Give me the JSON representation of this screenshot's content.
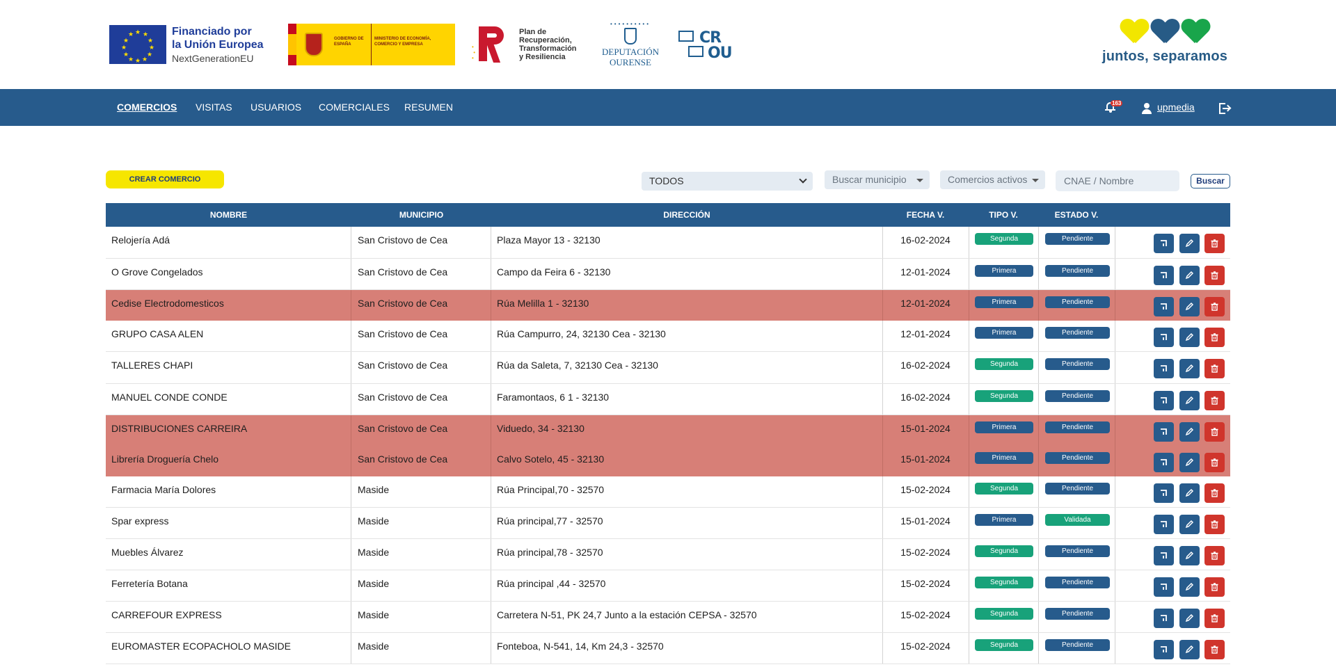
{
  "header": {
    "eu": {
      "line1": "Financiado por",
      "line2": "la Unión Europea",
      "line3": "NextGenerationEU"
    },
    "gobierno": {
      "block1": "GOBIERNO DE ESPAÑA",
      "block2": "MINISTERIO DE ECONOMÍA, COMERCIO Y EMPRESA"
    },
    "prtr": {
      "line1": "Plan de",
      "line2": "Recuperación,",
      "line3": "Transformación",
      "line4": "y Resiliencia"
    },
    "deputacion": {
      "line1": "DEPUTACIÓN",
      "line2": "OURENSE"
    },
    "crou": {
      "line1": "CR",
      "line2": "OU"
    },
    "juntos": {
      "text": "juntos, separamos"
    }
  },
  "nav": {
    "items": [
      {
        "label": "COMERCIOS",
        "active": true
      },
      {
        "label": "VISITAS",
        "active": false
      },
      {
        "label": "USUARIOS",
        "active": false
      },
      {
        "label": "COMERCIALES",
        "active": false
      },
      {
        "label": "RESUMEN",
        "active": false
      }
    ],
    "notifications_count": "163",
    "username": "upmedia"
  },
  "toolbar": {
    "crear_label": "CREAR COMERCIO",
    "filter_select_value": "TODOS",
    "municipio_placeholder": "Buscar municipio",
    "estado_value": "Comercios activos",
    "cnae_placeholder": "CNAE / Nombre",
    "buscar_label": "Buscar"
  },
  "table": {
    "columns": [
      "NOMBRE",
      "MUNICIPIO",
      "DIRECCIÓN",
      "FECHA V.",
      "TIPO V.",
      "ESTADO V."
    ],
    "rows": [
      {
        "nombre": "Relojería Adá",
        "municipio": "San Cristovo de Cea",
        "direccion": "Plaza Mayor 13 - 32130",
        "fecha": "16-02-2024",
        "tipo": "Segunda",
        "estado": "Pendiente",
        "highlight": false
      },
      {
        "nombre": "O Grove Congelados",
        "municipio": "San Cristovo de Cea",
        "direccion": "Campo da Feira 6 - 32130",
        "fecha": "12-01-2024",
        "tipo": "Primera",
        "estado": "Pendiente",
        "highlight": false
      },
      {
        "nombre": "Cedise Electrodomesticos",
        "municipio": "San Cristovo de Cea",
        "direccion": "Rúa Melilla 1 - 32130",
        "fecha": "12-01-2024",
        "tipo": "Primera",
        "estado": "Pendiente",
        "highlight": true
      },
      {
        "nombre": "GRUPO CASA ALEN",
        "municipio": "San Cristovo de Cea",
        "direccion": "Rúa Campurro, 24, 32130 Cea - 32130",
        "fecha": "12-01-2024",
        "tipo": "Primera",
        "estado": "Pendiente",
        "highlight": false
      },
      {
        "nombre": "TALLERES CHAPI",
        "municipio": "San Cristovo de Cea",
        "direccion": "Rúa da Saleta, 7, 32130 Cea - 32130",
        "fecha": "16-02-2024",
        "tipo": "Segunda",
        "estado": "Pendiente",
        "highlight": false
      },
      {
        "nombre": "MANUEL CONDE CONDE",
        "municipio": "San Cristovo de Cea",
        "direccion": "Faramontaos, 6 1 - 32130",
        "fecha": "16-02-2024",
        "tipo": "Segunda",
        "estado": "Pendiente",
        "highlight": false
      },
      {
        "nombre": "DISTRIBUCIONES CARREIRA",
        "municipio": "San Cristovo de Cea",
        "direccion": "Viduedo, 34 - 32130",
        "fecha": "15-01-2024",
        "tipo": "Primera",
        "estado": "Pendiente",
        "highlight": true
      },
      {
        "nombre": "Librería Droguería Chelo",
        "municipio": "San Cristovo de Cea",
        "direccion": "Calvo Sotelo, 45 - 32130",
        "fecha": "15-01-2024",
        "tipo": "Primera",
        "estado": "Pendiente",
        "highlight": true
      },
      {
        "nombre": "Farmacia María Dolores",
        "municipio": "Maside",
        "direccion": "Rúa Principal,70 - 32570",
        "fecha": "15-02-2024",
        "tipo": "Segunda",
        "estado": "Pendiente",
        "highlight": false
      },
      {
        "nombre": "Spar express",
        "municipio": "Maside",
        "direccion": "Rúa principal,77 - 32570",
        "fecha": "15-01-2024",
        "tipo": "Primera",
        "estado": "Validada",
        "highlight": false
      },
      {
        "nombre": "Muebles Álvarez",
        "municipio": "Maside",
        "direccion": "Rúa principal,78 - 32570",
        "fecha": "15-02-2024",
        "tipo": "Segunda",
        "estado": "Pendiente",
        "highlight": false
      },
      {
        "nombre": "Ferretería Botana",
        "municipio": "Maside",
        "direccion": "Rúa principal ,44 - 32570",
        "fecha": "15-02-2024",
        "tipo": "Segunda",
        "estado": "Pendiente",
        "highlight": false
      },
      {
        "nombre": "CARREFOUR EXPRESS",
        "municipio": "Maside",
        "direccion": "Carretera N-51, PK 24,7 Junto a la estación CEPSA - 32570",
        "fecha": "15-02-2024",
        "tipo": "Segunda",
        "estado": "Pendiente",
        "highlight": false
      },
      {
        "nombre": "EUROMASTER ECOPACHOLO MASIDE",
        "municipio": "Maside",
        "direccion": "Fonteboa, N-541, 14, Km 24,3 - 32570",
        "fecha": "15-02-2024",
        "tipo": "Segunda",
        "estado": "Pendiente",
        "highlight": false
      }
    ]
  },
  "colors": {
    "primary": "#275b8c",
    "accent_yellow": "#f6e600",
    "row_alert": "#d77f77",
    "badge_green": "#18a27a",
    "delete_red": "#d0352c"
  },
  "icons": [
    "notification-bell-icon",
    "user-icon",
    "logout-icon",
    "assign-icon",
    "edit-pencil-icon",
    "trash-icon",
    "chevron-down-icon"
  ]
}
